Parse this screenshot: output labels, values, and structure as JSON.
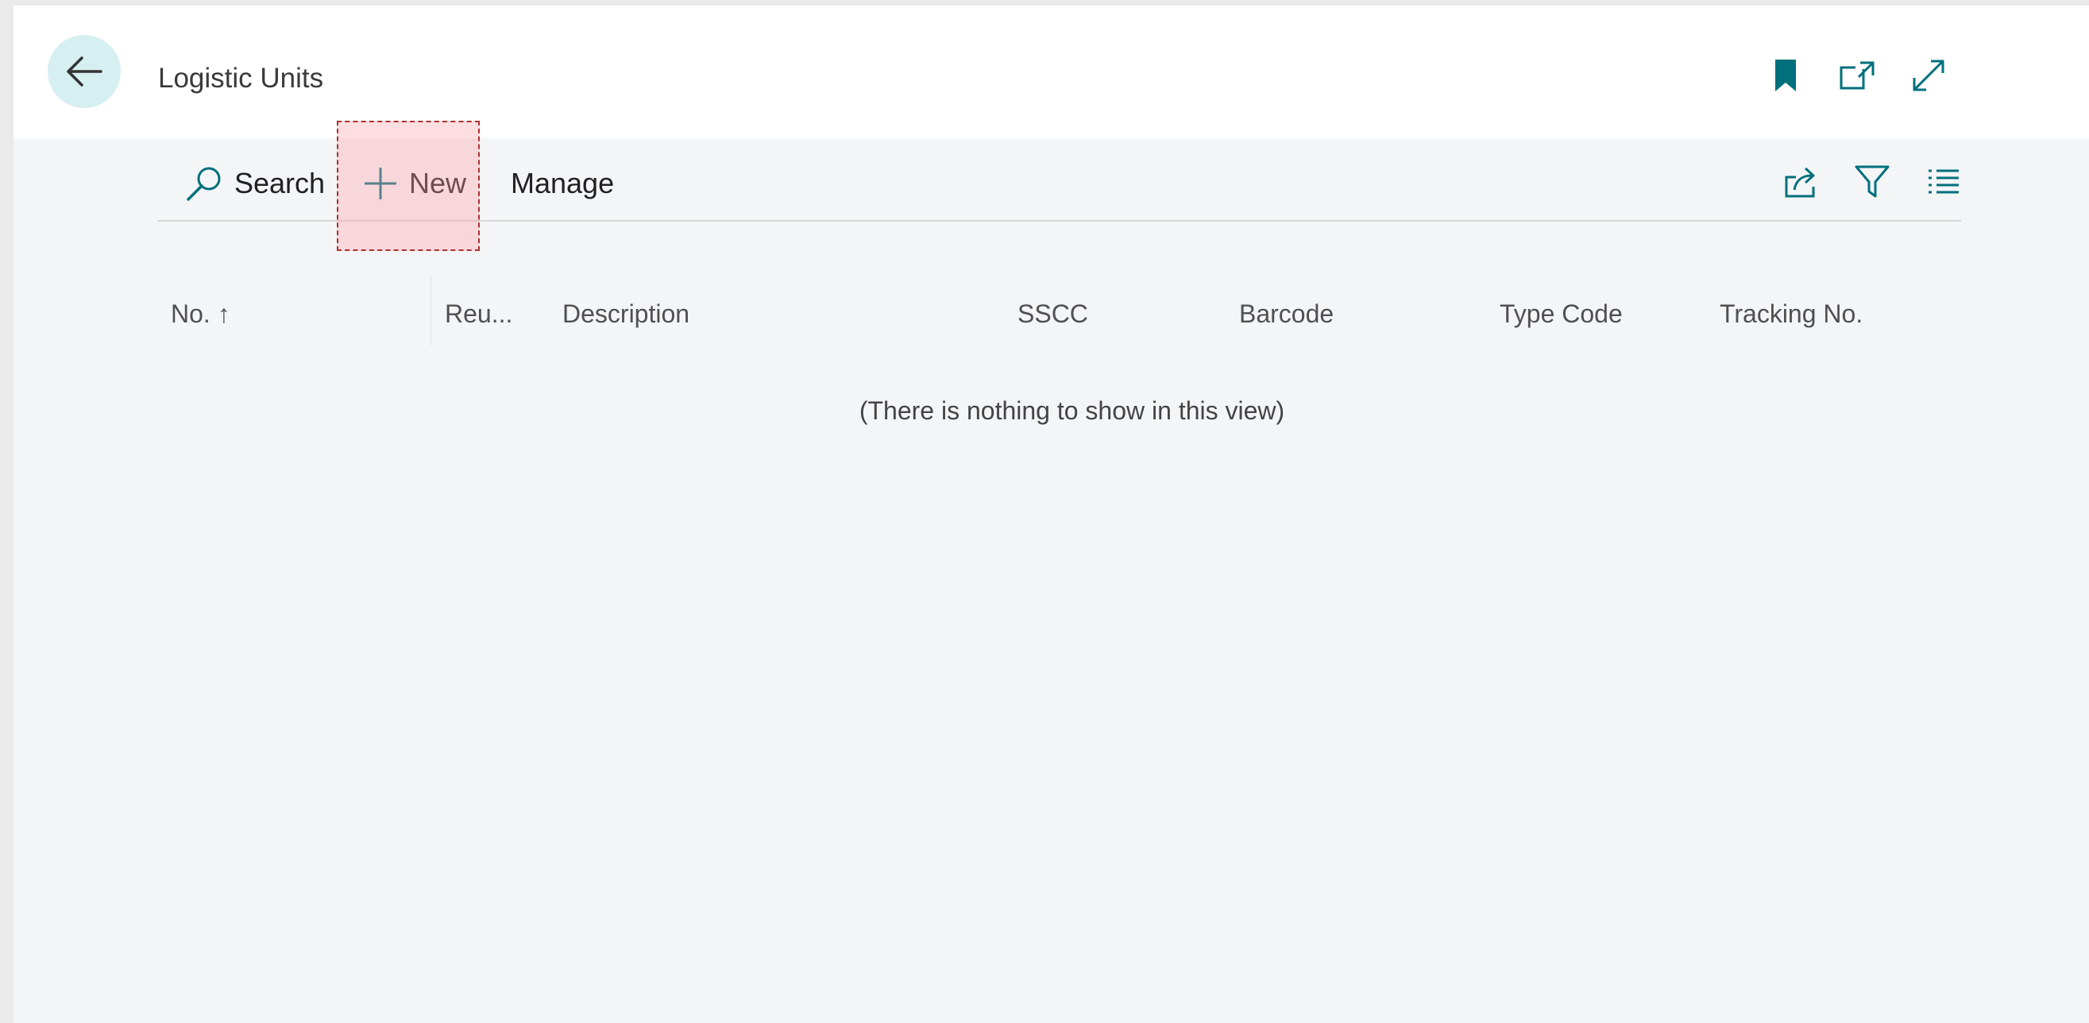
{
  "header": {
    "title": "Logistic Units",
    "icons": [
      "back-arrow-icon",
      "bookmark-icon",
      "open-in-new-window-icon",
      "expand-icon"
    ]
  },
  "toolbar": {
    "search_label": "Search",
    "new_label": "New",
    "manage_label": "Manage",
    "right_icons": [
      "share-icon",
      "filter-icon",
      "list-view-icon"
    ]
  },
  "grid": {
    "columns": [
      "No. ↑",
      "Reu...",
      "Description",
      "SSCC",
      "Barcode",
      "Type Code",
      "Tracking No."
    ],
    "rows": [],
    "empty_message": "(There is nothing to show in this view)"
  },
  "colors": {
    "accent": "#00707c",
    "background": "#f4f5f7",
    "highlight": "#f7d3d8"
  }
}
